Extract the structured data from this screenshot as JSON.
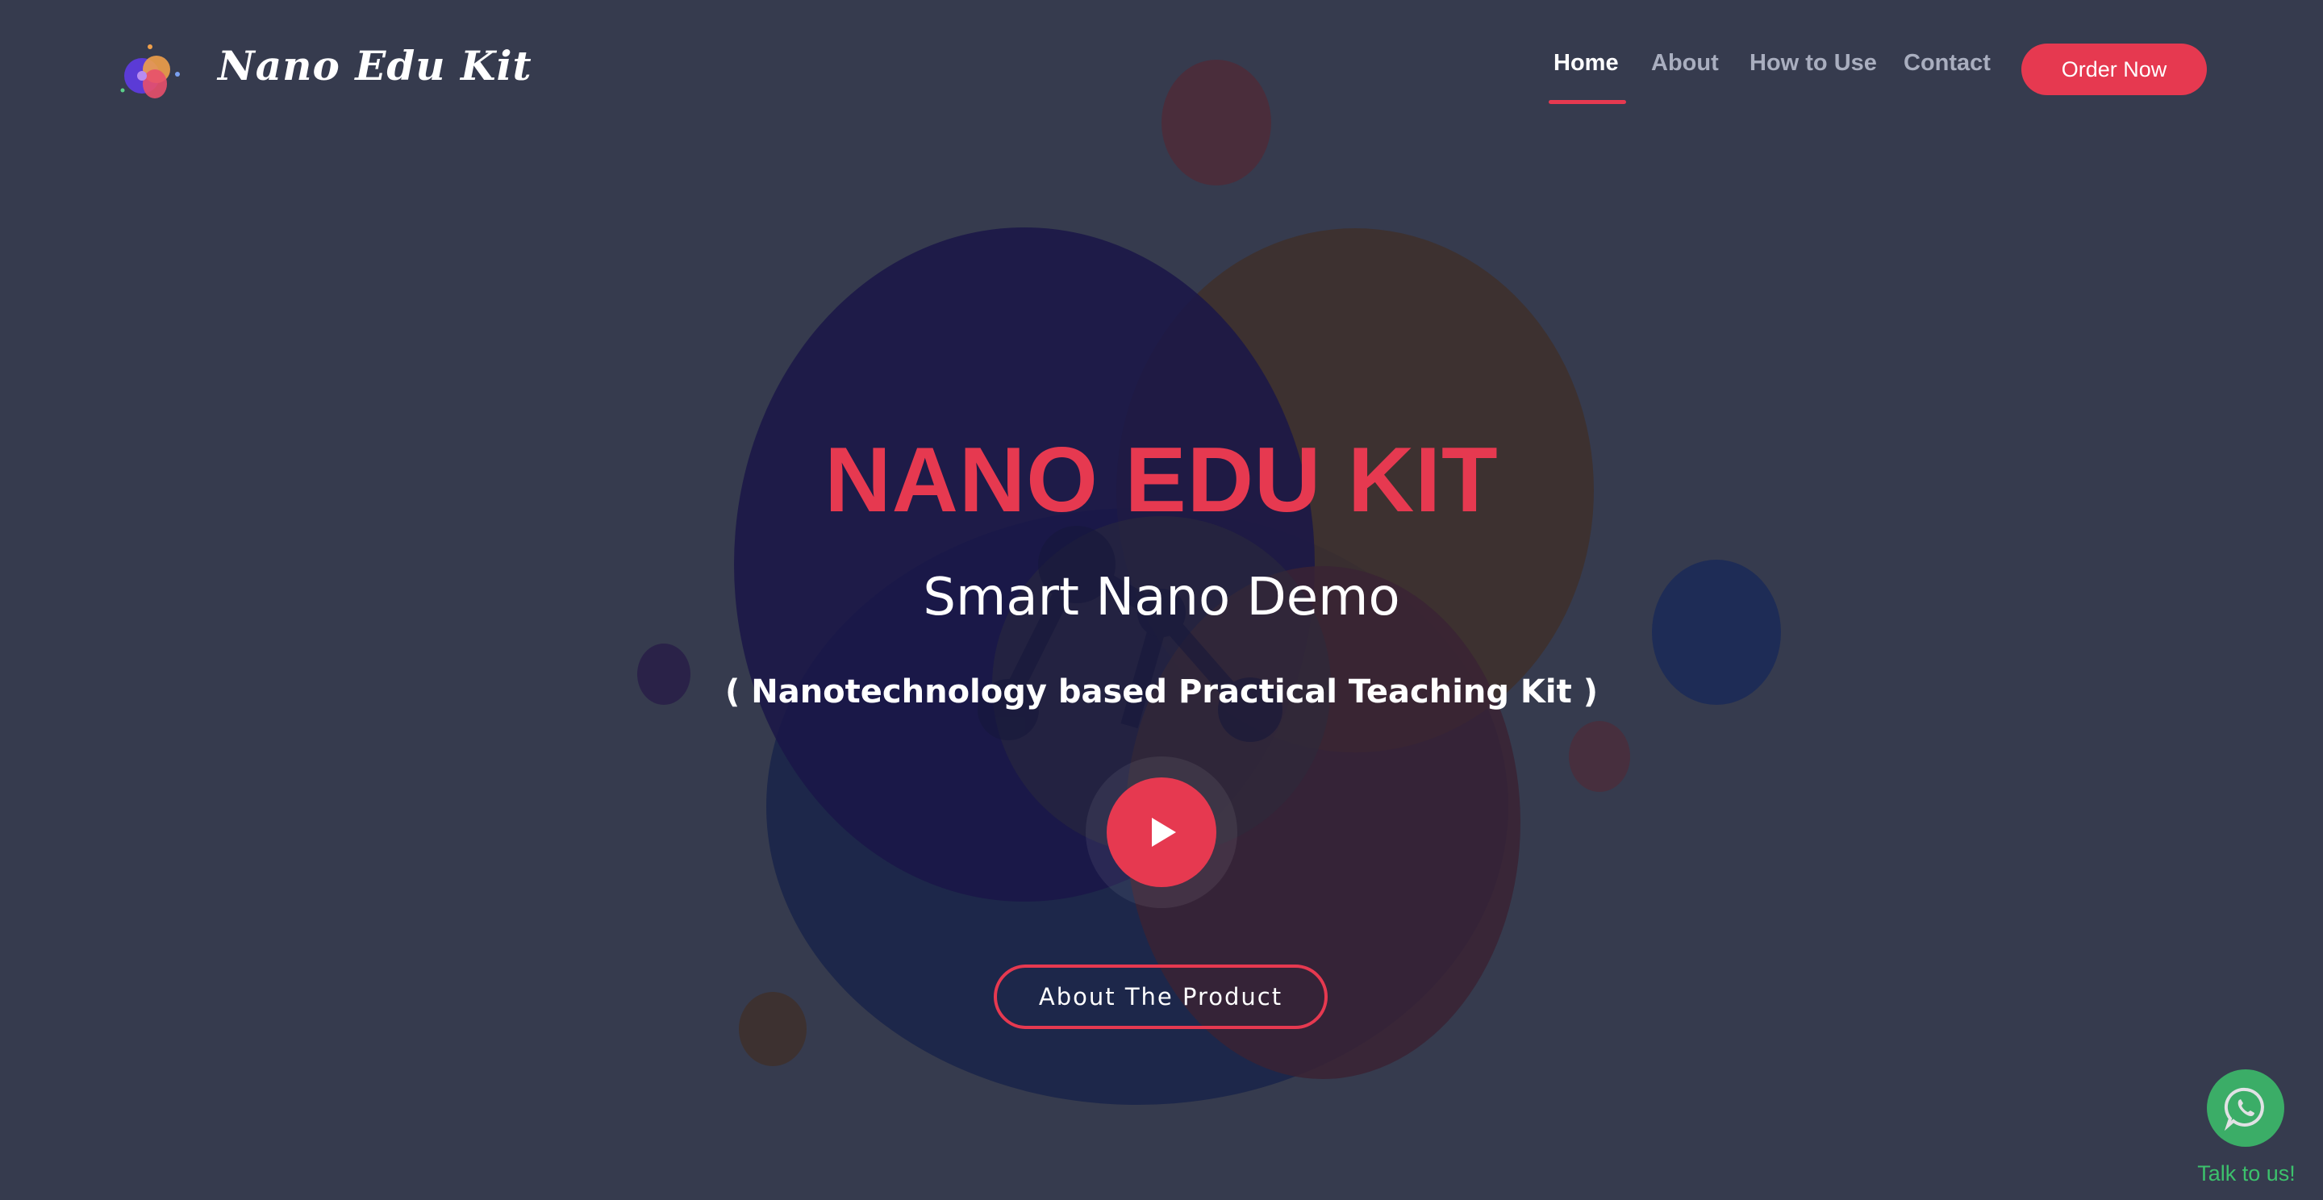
{
  "brand": {
    "name": "Nano Edu Kit",
    "logo_icon": "nano-atom-logo-icon"
  },
  "nav": {
    "items": [
      {
        "label": "Home",
        "active": true
      },
      {
        "label": "About",
        "active": false
      },
      {
        "label": "How to Use",
        "active": false
      },
      {
        "label": "Contact",
        "active": false
      }
    ],
    "order_label": "Order Now"
  },
  "hero": {
    "title": "NANO EDU KIT",
    "subtitle": "Smart Nano Demo",
    "description": "( Nanotechnology based Practical Teaching Kit )",
    "play_icon": "play-icon",
    "cta_label": "About The Product"
  },
  "chat": {
    "icon": "whatsapp-icon",
    "label": "Talk to us!"
  },
  "colors": {
    "background": "#363b4e",
    "accent": "#e63950",
    "chat_green": "#3cc16c"
  }
}
